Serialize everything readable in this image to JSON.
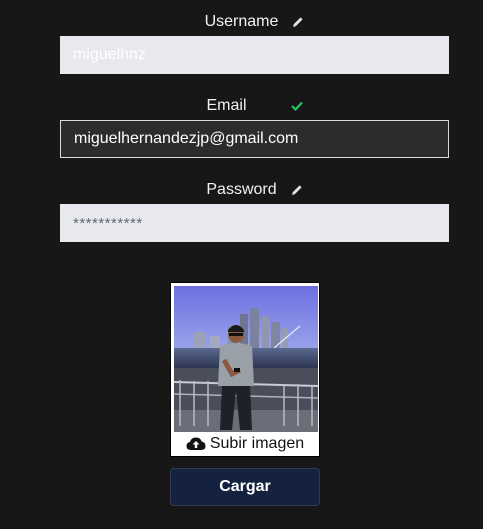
{
  "form": {
    "username": {
      "label": "Username",
      "value": "miguelhnz",
      "status_icon": "pencil-icon"
    },
    "email": {
      "label": "Email",
      "value": "miguelhernandezjp@gmail.com",
      "status_icon": "check-icon",
      "status_color": "#22c55e"
    },
    "password": {
      "label": "Password",
      "value": "***********",
      "status_icon": "pencil-icon"
    }
  },
  "avatar": {
    "upload_label": "Subir imagen",
    "upload_icon": "cloud-upload-icon"
  },
  "submit_label": "Cargar",
  "colors": {
    "background": "#171717",
    "button": "#14213f",
    "input_light": "#e8e9ee",
    "input_dark": "#2c2c2c"
  }
}
